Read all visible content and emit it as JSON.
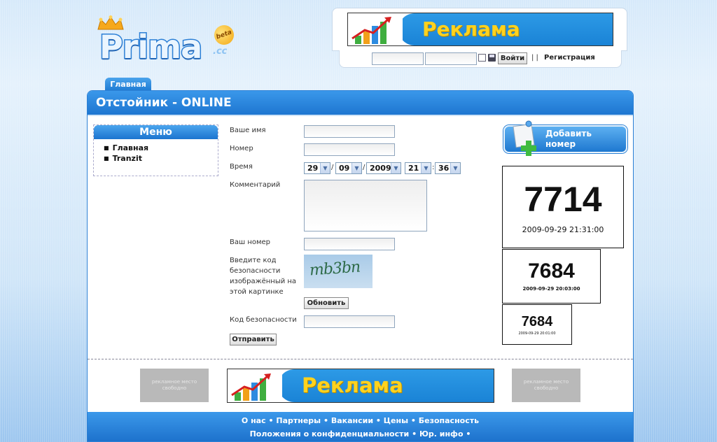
{
  "logo": {
    "wordmark": "Prima",
    "suffix": ".cc",
    "badge": "beta"
  },
  "ads": {
    "top_banner_text": "Реклама",
    "bottom_banner_text": "Реклама",
    "free_slot_left": "рекламное место свободно",
    "free_slot_right": "рекламное место свободно"
  },
  "login": {
    "login_button": "Войти",
    "separator": "| |",
    "register_link": "Регистрация"
  },
  "nav": {
    "tab_main": "Главная"
  },
  "panel": {
    "title": "Отстойник - ONLINE"
  },
  "menu": {
    "title": "Меню",
    "items": [
      "Главная",
      "Tranzit"
    ]
  },
  "form": {
    "name_label": "Ваше имя",
    "number_label": "Номер",
    "time_label": "Время",
    "time": {
      "day": "29",
      "month": "09",
      "year": "2009",
      "hour": "21",
      "minute": "36",
      "date_sep": "/",
      "time_sep": ":"
    },
    "comment_label": "Комментарий",
    "your_number_label": "Ваш номер",
    "captcha_prompt": "Введите код безопасности изображённый на этой картинке",
    "captcha_text": "mb3bn",
    "refresh_button": "Обновить",
    "security_code_label": "Код безопасности",
    "submit_button": "Отправить"
  },
  "right": {
    "add_number_line1": "Добавить",
    "add_number_line2": "номер",
    "cards": [
      {
        "number": "7714",
        "timestamp": "2009-09-29 21:31:00"
      },
      {
        "number": "7684",
        "timestamp": "2009-09-29 20:03:00"
      },
      {
        "number": "7684",
        "timestamp": "2009-09-29 20:01:00"
      }
    ]
  },
  "footer": {
    "line1": [
      "О нас",
      "Партнеры",
      "Вакансии",
      "Цены",
      "Безопасность"
    ],
    "line2": [
      "Положения о конфиденциальности",
      "Юр. инфо"
    ],
    "bullet": "•"
  },
  "colors": {
    "accent": "#1e7bd3",
    "ad_text": "#ffd21e",
    "header_text": "#ffffff"
  }
}
